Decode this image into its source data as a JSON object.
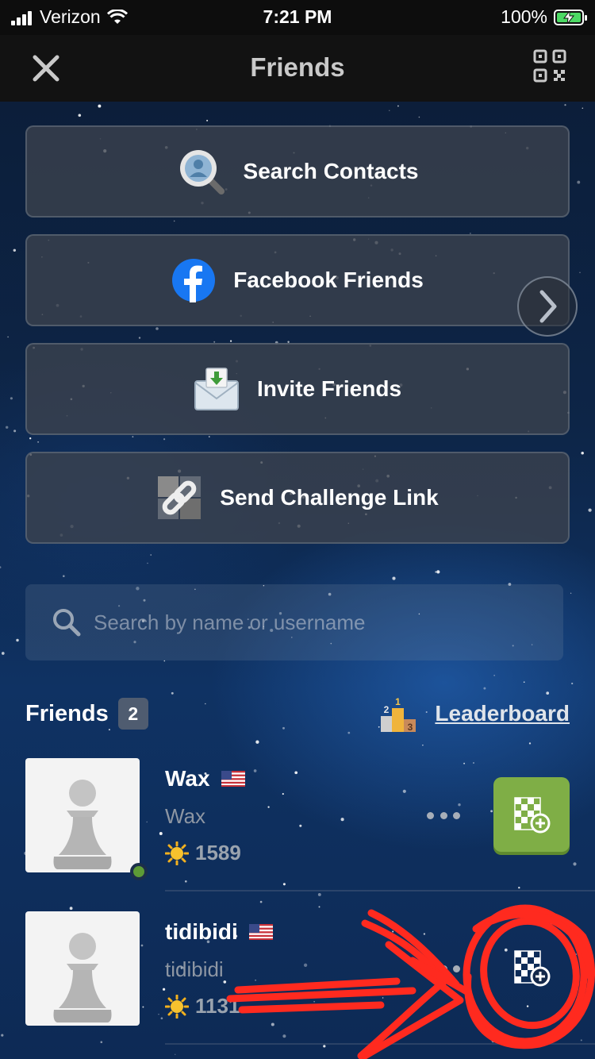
{
  "status_bar": {
    "carrier": "Verizon",
    "time": "7:21 PM",
    "battery": "100%"
  },
  "nav": {
    "title": "Friends",
    "left_icon": "close-icon",
    "right_icon": "qr-code-icon"
  },
  "actions": [
    {
      "label": "Search Contacts",
      "icon": "contact-search-icon"
    },
    {
      "label": "Facebook Friends",
      "icon": "facebook-icon"
    },
    {
      "label": "Invite Friends",
      "icon": "envelope-invite-icon"
    },
    {
      "label": "Send Challenge Link",
      "icon": "link-icon"
    }
  ],
  "search": {
    "placeholder": "Search by name or username",
    "value": ""
  },
  "friends_section": {
    "title": "Friends",
    "count": "2",
    "leaderboard_label": "Leaderboard",
    "podium_numbers": [
      "2",
      "1",
      "3"
    ]
  },
  "friends": [
    {
      "name": "Wax",
      "username": "Wax",
      "rating": "1589",
      "flag": "us",
      "online": true,
      "challenge_style": "green"
    },
    {
      "name": "tidibidi",
      "username": "tidibidi",
      "rating": "1131",
      "flag": "us",
      "online": false,
      "challenge_style": "plain"
    }
  ],
  "colors": {
    "accent_green": "#7fae46",
    "annotation_red": "#ff2a1f",
    "online_green": "#5d9b36",
    "facebook_blue": "#1877f2"
  }
}
